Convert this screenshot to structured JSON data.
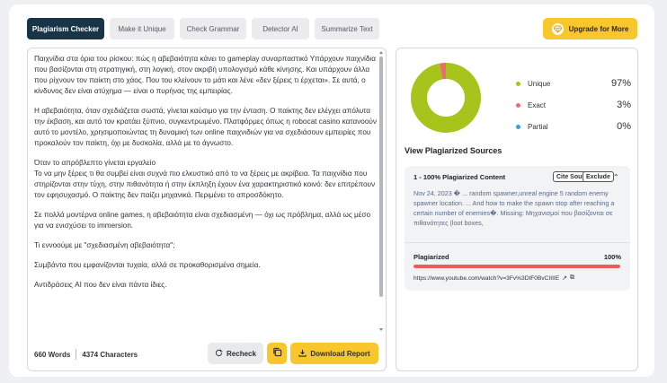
{
  "tabs": [
    {
      "label": "Plagiarism Checker",
      "active": true
    },
    {
      "label": "Make it Unique",
      "active": false
    },
    {
      "label": "Check Grammar",
      "active": false
    },
    {
      "label": "Detector AI",
      "active": false
    },
    {
      "label": "Summarize Text",
      "active": false
    }
  ],
  "upgrade": {
    "label": "Upgrade for More",
    "icon": "gem-icon"
  },
  "editor": {
    "paragraphs": [
      "Παιχνίδια στα όρια του ρίσκου: πώς η αβεβαιότητα κάνει το gameplay συναρπαστικό Υπάρχουν παιχνίδια που βασίζονται στη στρατηγική, στη λογική, στον ακριβή υπολογισμό κάθε κίνησης. Και υπάρχουν άλλα που ρίχνουν τον παίκτη στο χάος. Που του κλείνουν το μάτι και λένε «δεν ξέρεις τι έρχεται». Σε αυτά, ο κίνδυνος δεν είναι ατύχημα — είναι ο πυρήνας της εμπειρίας.",
      "Η αβεβαιότητα, όταν σχεδιάζεται σωστά, γίνεται καύσιμο για την ένταση. Ο παίκτης δεν ελέγχει απόλυτα την έκβαση, και αυτό τον κρατάει ξύπνιο, συγκεντρωμένο. Πλατφόρμες όπως η robocat casino κατανοούν αυτό το μοντέλο, χρησιμοποιώντας τη δυναμική των online παιχνιδιών για να σχεδιάσουν εμπειρίες που προκαλούν τον παίκτη, όχι με δυσκολία, αλλά με το άγνωστο.",
      "Όταν το απρόβλεπτο γίνεται εργαλείο\nΤο να μην ξέρεις τι θα συμβεί είναι συχνά πιο ελκυστικό από το να ξέρεις με ακρίβεια. Τα παιχνίδια που στηρίζονται στην τύχη, στην πιθανότητα ή στην έκπληξη έχουν ένα χαρακτηριστικό κοινό: δεν επιτρέπουν τον εφησυχασμό. Ο παίκτης δεν παίζει μηχανικά. Περιμένει το απροσδόκητο.",
      "Σε πολλά μοντέρνα online games, η αβεβαιότητα είναι σχεδιασμένη — όχι ως πρόβλημα, αλλά ως μέσο για να ενισχύσει το immersion.",
      "Τι εννοούμε με \"σχεδιασμένη αβεβαιότητα\";",
      "Συμβάντα που εμφανίζονται τυχαία, αλλά σε προκαθορισμένα σημεία.",
      "Αντιδράσεις AI που δεν είναι πάντα ίδιες."
    ],
    "words": "660 Words",
    "characters": "4374 Characters",
    "recheck_label": "Recheck",
    "download_label": "Download Report"
  },
  "results": {
    "unique_pct": 97,
    "exact_pct": 3,
    "partial_pct": 0,
    "legend": [
      {
        "name": "Unique",
        "value": "97%",
        "color": "#a7c41c"
      },
      {
        "name": "Exact",
        "value": "3%",
        "color": "#ef6b73"
      },
      {
        "name": "Partial",
        "value": "0%",
        "color": "#3b9fd6"
      }
    ],
    "sources_title": "View Plagiarized Sources",
    "source": {
      "heading": "1 - 100% Plagiarized Content",
      "cite_label": "Cite Source",
      "exclude_label": "Exclude",
      "snippet": "Nov 24, 2023 � ... random spawner,unreal engine 5 random enemy spawner location. ... And how to make the spawn stop after reaching a certain number of enemies�. Missing: Μηχανισμοί που βασίζονται σε πιθανότητες (loot boxes,",
      "plagiarized_label": "Plagiarized",
      "plagiarized_pct": "100%",
      "plagiarized_fraction": 1.0,
      "url": "https://www.youtube.com/watch?v=3Fv%3DtF0BvCIIIIE"
    }
  },
  "colors": {
    "active_tab": "#173547",
    "accent_yellow": "#f9c62b",
    "unique": "#a7c41c",
    "exact": "#ef6b73",
    "partial": "#3b9fd6",
    "bar": "#ef5b5b"
  }
}
